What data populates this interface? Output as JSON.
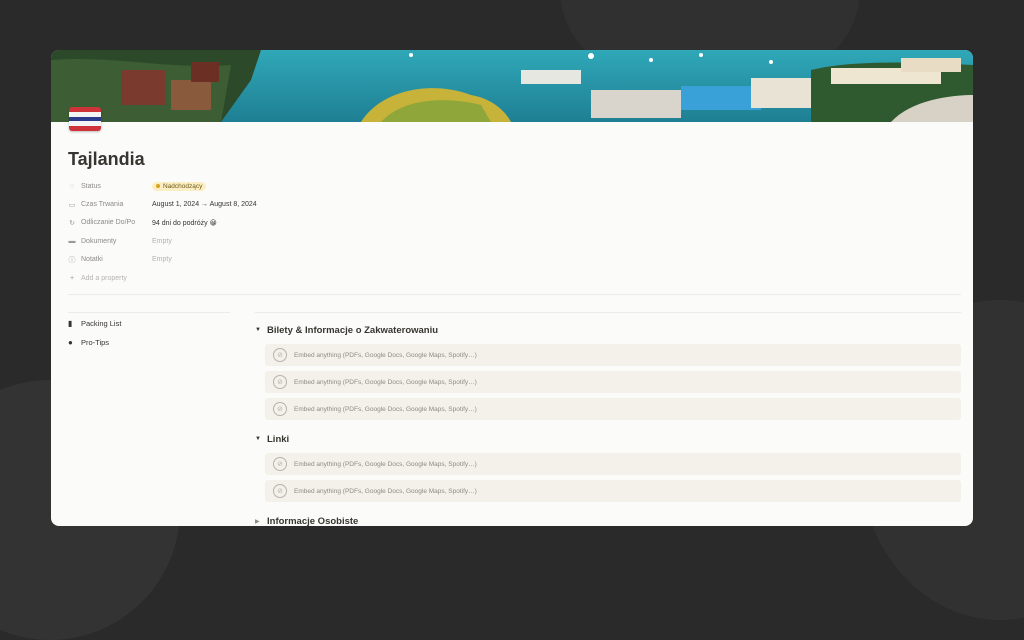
{
  "page": {
    "title": "Tajlandia",
    "icon": "thailand-flag-icon"
  },
  "properties": [
    {
      "icon": "status-icon",
      "key": "Status",
      "value": "Nadchodzący",
      "type": "badge"
    },
    {
      "icon": "calendar-icon",
      "key": "Czas Trwania",
      "value": "August 1, 2024 → August 8, 2024",
      "type": "text"
    },
    {
      "icon": "countdown-icon",
      "key": "Odliczanie Do/Po",
      "value": "94 dni do podróży 😀",
      "type": "text"
    },
    {
      "icon": "folder-icon",
      "key": "Dokumenty",
      "value": "Empty",
      "type": "empty"
    },
    {
      "icon": "info-icon",
      "key": "Notatki",
      "value": "Empty",
      "type": "empty"
    }
  ],
  "add_property_label": "Add a property",
  "sidebar": {
    "items": [
      {
        "icon": "luggage-icon",
        "label": "Packing List"
      },
      {
        "icon": "lightbulb-icon",
        "label": "Pro-Tips"
      }
    ]
  },
  "sections": [
    {
      "title": "Bilety & Informacje o Zakwaterowaniu",
      "expanded": true,
      "embeds": [
        "Embed anything (PDFs, Google Docs, Google Maps, Spotify…)",
        "Embed anything (PDFs, Google Docs, Google Maps, Spotify…)",
        "Embed anything (PDFs, Google Docs, Google Maps, Spotify…)"
      ]
    },
    {
      "title": "Linki",
      "expanded": true,
      "embeds": [
        "Embed anything (PDFs, Google Docs, Google Maps, Spotify…)",
        "Embed anything (PDFs, Google Docs, Google Maps, Spotify…)"
      ]
    },
    {
      "title": "Informacje Osobiste",
      "expanded": false,
      "embeds": []
    }
  ],
  "colors": {
    "badge_bg": "#fbeec2",
    "badge_dot": "#d9a21c",
    "embed_bg": "#f3f1ea"
  }
}
